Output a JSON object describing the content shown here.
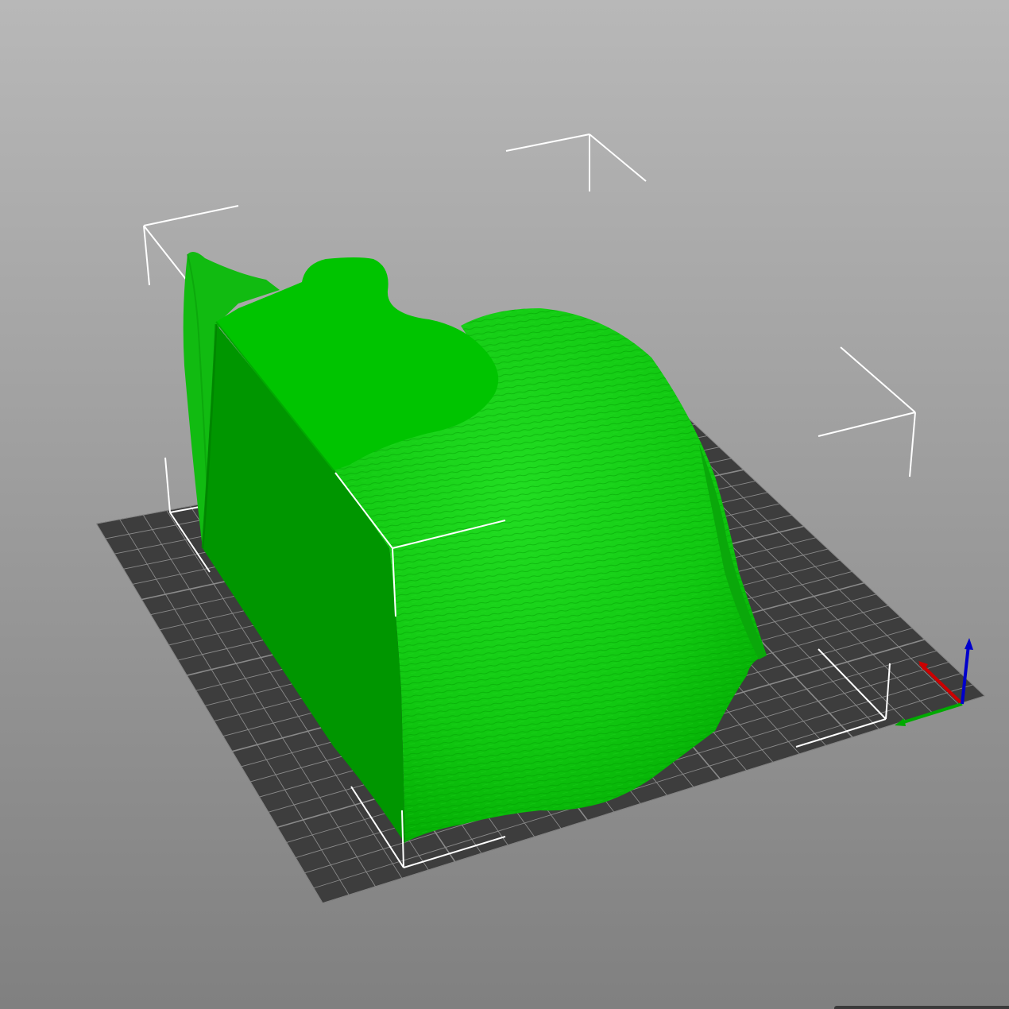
{
  "viewport": {
    "background_top": "#b8b8b8",
    "background_bottom": "#808080"
  },
  "bed": {
    "fill": "#3d3d3d",
    "grid_line": "#8a8a8a",
    "grid_divisions": 25
  },
  "model": {
    "color_top": "#00c400",
    "color_lit": "#22dd22",
    "color_side": "#009600",
    "color_shadow": "#008a00"
  },
  "bounding_box": {
    "color": "#ffffff"
  },
  "axes": {
    "x_color": "#cc0000",
    "y_color": "#00aa00",
    "z_color": "#0000cc"
  },
  "icons": {
    "axes_gizmo": "xyz-axes-icon"
  }
}
